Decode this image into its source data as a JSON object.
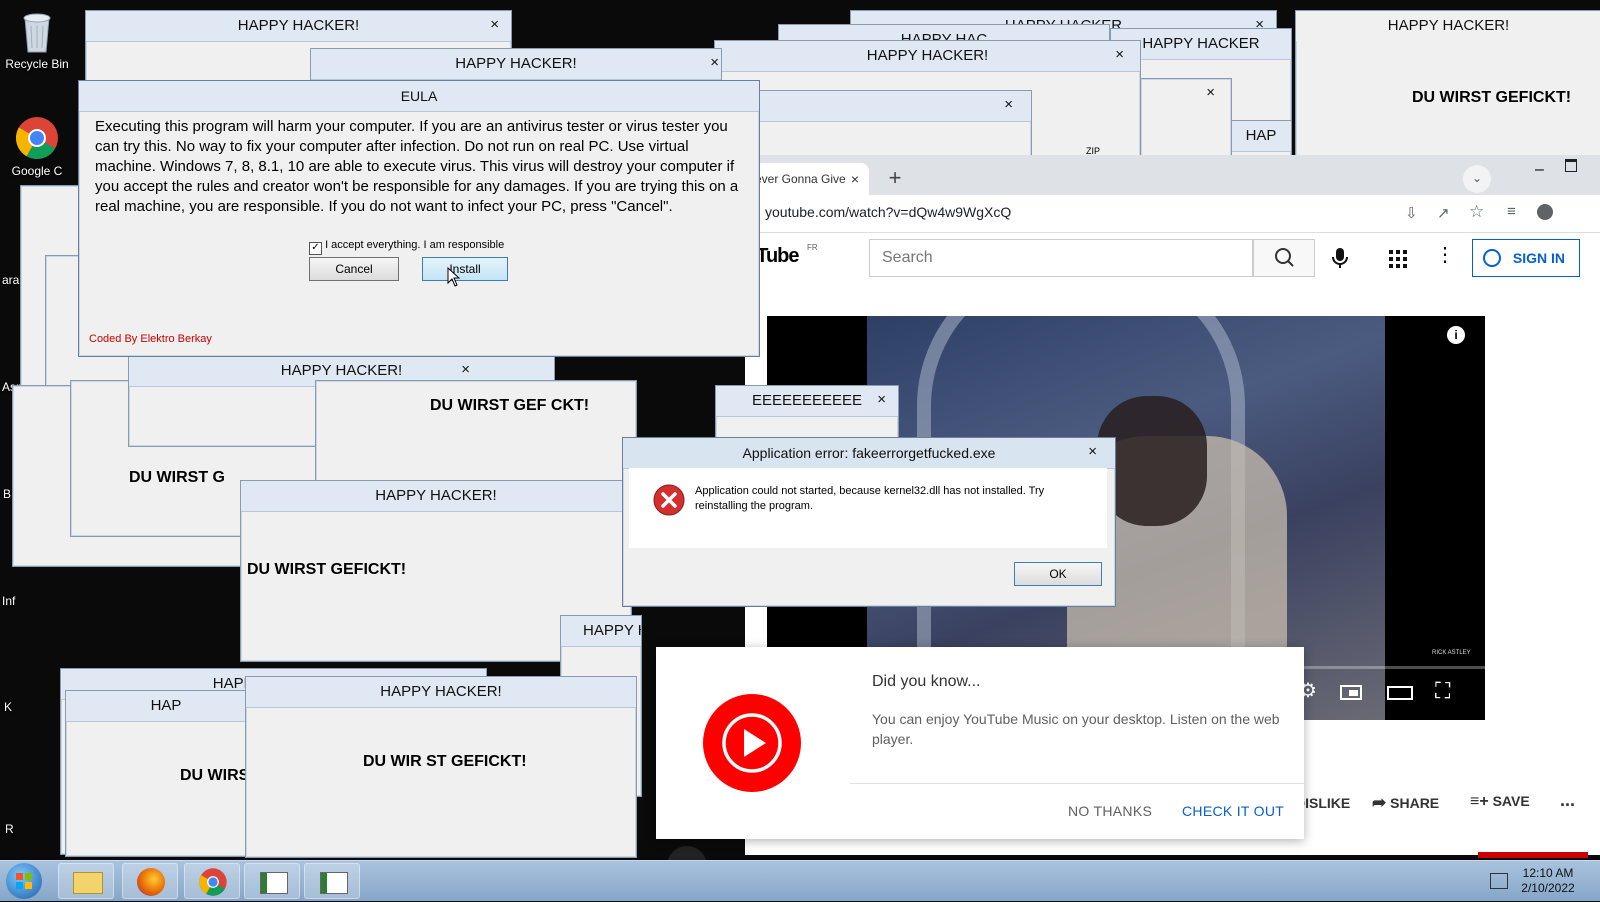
{
  "desktop": {
    "icons": [
      {
        "label": "Recycle Bin"
      },
      {
        "label": "Google Chrome",
        "short": "Google C"
      }
    ],
    "partial_labels": [
      "ara",
      "Asma",
      "B",
      "Inf",
      "K",
      "R"
    ]
  },
  "popups": {
    "title": "HAPPY HACKER!",
    "titles_partial": [
      "HAPPY HAC",
      "HAPPY HACKER",
      "HAP",
      "HAPPY H",
      "HAPPY HACKER!",
      "HAP"
    ],
    "message": "DU WIRST GEFICKT!",
    "message_partials": [
      "DU WIRST G",
      "DU WIRST GEF CKT!",
      "DU WIRST GEFICKT!",
      "DU WIRS",
      "DU WIR ST GEFICKT!"
    ],
    "close": "×",
    "misc_title": "EEEEEEEEEEE",
    "misc_tag": "ZIP"
  },
  "eula": {
    "title": "EULA",
    "text": "Executing this program will harm your computer. If you are an antivirus tester or virus tester you can try this. No way to fix your computer after infection. Do not run on real PC. Use virtual machine. Windows 7, 8, 8.1, 10 are able to execute virus. This virus will destroy your computer if you accept the rules and creator won't be responsible for any damages. If you are trying this on a real machine, you are responsible. If you do not want to infect your PC, press \"Cancel\".",
    "checkbox_label": "I accept everything. I am responsible",
    "checkbox_checked": true,
    "cancel": "Cancel",
    "install": "Install",
    "credit": "Coded By Elektro Berkay"
  },
  "error_dialog": {
    "title": "Application error: fakeerrorgetfucked.exe",
    "message": "Application could not started, because kernel32.dll has not installed. Try reinstalling the program.",
    "ok": "OK"
  },
  "browser": {
    "tab_title": "ever Gonna Give",
    "tab_close": "×",
    "new_tab": "+",
    "url": "youtube.com/watch?v=dQw4w9WgXcQ",
    "logo_partial": "uTube",
    "region": "FR",
    "search_placeholder": "Search",
    "signin": "SIGN IN",
    "video_watermark": "RICK ASTLEY",
    "actions": {
      "dislike": "DISLIKE",
      "share": "SHARE",
      "save": "SAVE",
      "more": "..."
    }
  },
  "yt_music_popup": {
    "heading": "Did you know...",
    "body": "You can enjoy YouTube Music on your desktop. Listen on the web player.",
    "no_thanks": "NO THANKS",
    "check_it_out": "CHECK IT OUT"
  },
  "taskbar": {
    "time": "12:10 AM",
    "date": "2/10/2022"
  },
  "colors": {
    "yt_red": "#ff0000",
    "yt_blue": "#065fd4",
    "error_red": "#d32f2f",
    "credit_red": "#cc0000"
  }
}
